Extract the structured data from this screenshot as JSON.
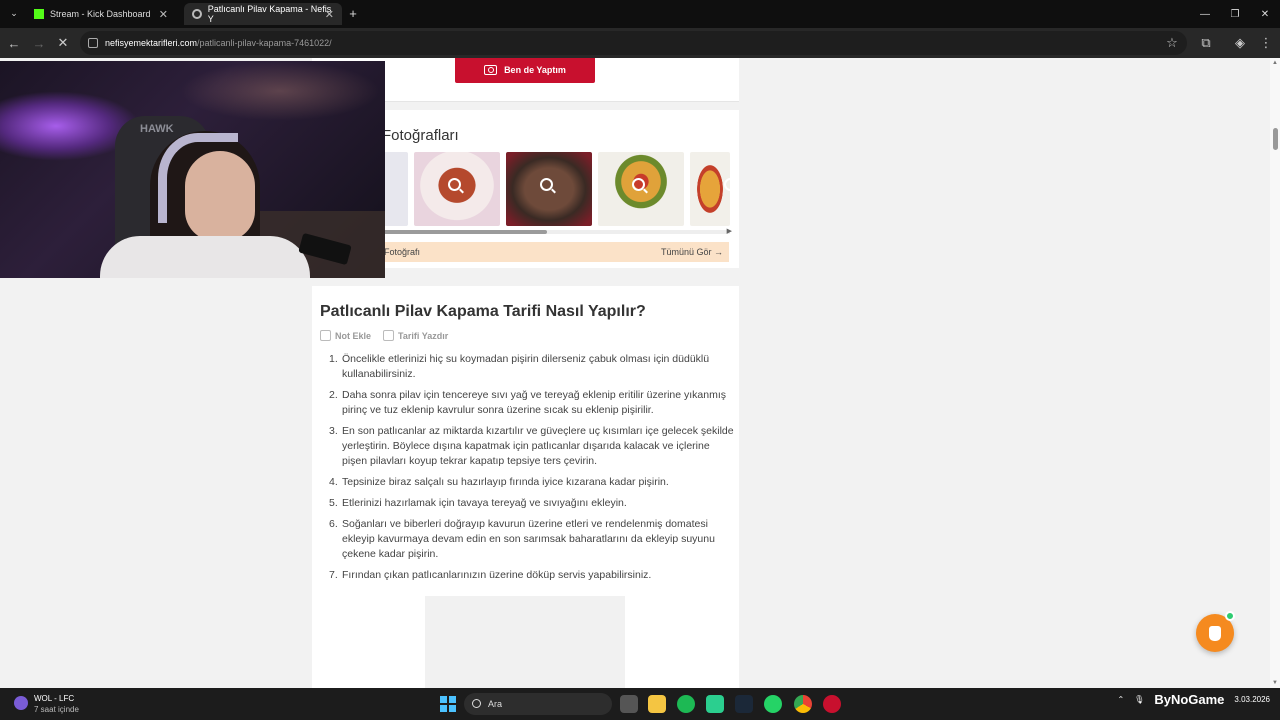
{
  "browser": {
    "tabs": [
      {
        "label": "Stream - Kick Dashboard",
        "active": false
      },
      {
        "label": "Patlıcanlı Pilav Kapama - Nefis Y",
        "active": true
      }
    ],
    "new_tab_label": "+",
    "url_domain": "nefisyemektarifleri.com",
    "url_path": "/patlicanli-pilav-kapama-7461022/"
  },
  "page": {
    "made_button_label": "Ben de Yaptım",
    "photos_title": "Fotoğrafları",
    "photos_footer_left": "Fotoğrafı",
    "photos_footer_right": "Tümünü Gör →",
    "recipe_title": "Patlıcanlı Pilav Kapama Tarifi Nasıl Yapılır?",
    "actions": {
      "note": "Not Ekle",
      "print": "Tarifi Yazdır"
    },
    "steps": [
      "Öncelikle etlerinizi hiç su koymadan pişirin dilerseniz çabuk olması için düdüklü kullanabilirsiniz.",
      "Daha sonra pilav için tencereye sıvı yağ ve tereyağ eklenip eritilir üzerine yıkanmış pirinç ve tuz eklenip kavrulur sonra üzerine sıcak su eklenip pişirilir.",
      "En son patlıcanlar az miktarda kızartılır ve güveçlere uç kısımları içe gelecek şekilde yerleştirin. Böylece dışına kapatmak için patlıcanlar dışarıda kalacak ve içlerine pişen pilavları koyup tekrar kapatıp tepsiye ters çevirin.",
      "Tepsinize biraz salçalı su hazırlayıp fırında iyice kızarana kadar pişirin.",
      "Etlerinizi hazırlamak için tavaya tereyağ ve sıvıyağını ekleyin.",
      "Soğanları ve biberleri doğrayıp kavurun üzerine etleri ve rendelenmiş domatesi ekleyip kavurmaya devam edin en son sarımsak baharatlarını da ekleyip suyunu çekene kadar pişirin.",
      "Fırından çıkan patlıcanlarınızın üzerine döküp servis yapabilirsiniz."
    ],
    "step_numbers": [
      "1.",
      "2.",
      "3.",
      "4.",
      "5.",
      "6.",
      "7."
    ]
  },
  "webcam": {
    "chair_logo": "HAWK"
  },
  "taskbar": {
    "weather_title": "WOL - LFC",
    "weather_sub": "7 saat içinde",
    "search_label": "Ara",
    "watermark": "ByNoGame",
    "date": "3.03.2026"
  },
  "colors": {
    "brand_red": "#c8102e",
    "fab_orange": "#f58a1f",
    "kick_green": "#53fc18"
  }
}
